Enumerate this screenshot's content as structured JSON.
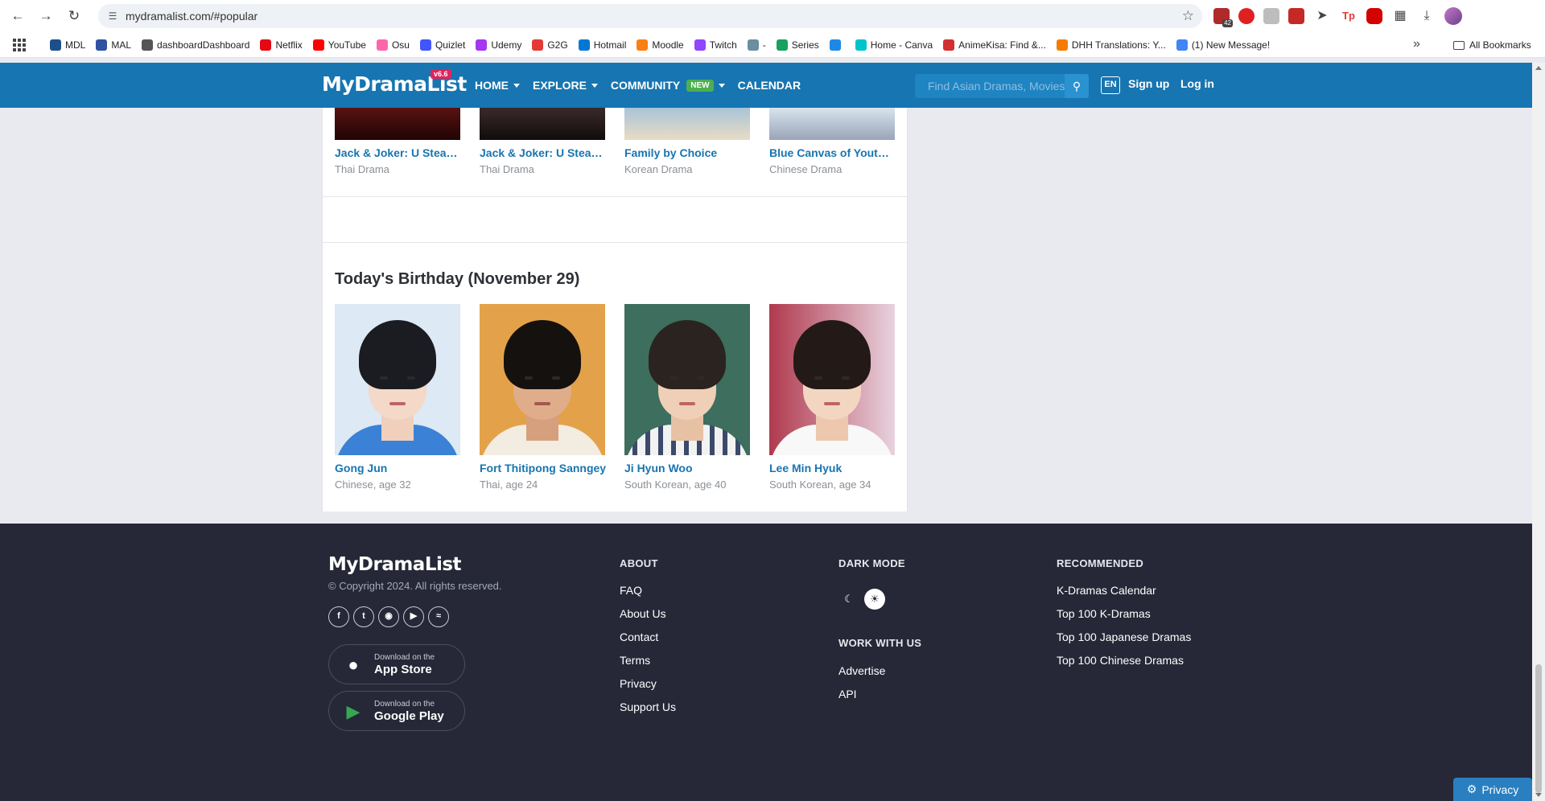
{
  "browser": {
    "url": "mydramalist.com/#popular",
    "bookmarks": [
      {
        "label": "MDL",
        "color": "#1d4f8c"
      },
      {
        "label": "MAL",
        "color": "#2e51a2"
      },
      {
        "label": "dashboardDashboard",
        "color": "#555555"
      },
      {
        "label": "Netflix",
        "color": "#e50914"
      },
      {
        "label": "YouTube",
        "color": "#ff0000"
      },
      {
        "label": "Osu",
        "color": "#ff66aa"
      },
      {
        "label": "Quizlet",
        "color": "#4255ff"
      },
      {
        "label": "Udemy",
        "color": "#a435f0"
      },
      {
        "label": "G2G",
        "color": "#e53935"
      },
      {
        "label": "Hotmail",
        "color": "#0078d4"
      },
      {
        "label": "Moodle",
        "color": "#f98012"
      },
      {
        "label": "Twitch",
        "color": "#9146ff"
      },
      {
        "label": "-",
        "color": "#6a8fa0"
      },
      {
        "label": "Series",
        "color": "#19a15f"
      },
      {
        "label": "",
        "color": "#1e88e5"
      },
      {
        "label": "Home - Canva",
        "color": "#00c4cc"
      },
      {
        "label": "AnimeKisa: Find &...",
        "color": "#d32f2f"
      },
      {
        "label": "DHH Translations: Y...",
        "color": "#f57c00"
      },
      {
        "label": "(1) New Message!",
        "color": "#4285f4"
      }
    ],
    "all_bookmarks": "All Bookmarks",
    "extension_badge": "42"
  },
  "header": {
    "logo": "MyDramaList",
    "version": "v6.6",
    "nav": {
      "home": "HOME",
      "explore": "EXPLORE",
      "community": "COMMUNITY",
      "new_badge": "NEW",
      "calendar": "CALENDAR"
    },
    "search_placeholder": "Find Asian Dramas, Movies, Actors...",
    "lang": "EN",
    "signup": "Sign up",
    "login": "Log in"
  },
  "popular_cards": [
    {
      "title": "Jack & Joker: U Steal My Heart!",
      "sub": "Thai Drama"
    },
    {
      "title": "Jack & Joker: U Steal My Heart!",
      "sub": "Thai Drama"
    },
    {
      "title": "Family by Choice",
      "sub": "Korean Drama"
    },
    {
      "title": "Blue Canvas of Youthful Days",
      "sub": "Chinese Drama"
    }
  ],
  "birthday": {
    "title": "Today's Birthday (November 29)",
    "people": [
      {
        "name": "Gong Jun",
        "sub": "Chinese, age 32"
      },
      {
        "name": "Fort Thitipong Sanngey",
        "sub": "Thai, age 24"
      },
      {
        "name": "Ji Hyun Woo",
        "sub": "South Korean, age 40"
      },
      {
        "name": "Lee Min Hyuk",
        "sub": "South Korean, age 34"
      }
    ]
  },
  "footer": {
    "logo": "MyDramaList",
    "copyright": "© Copyright 2024. All rights reserved.",
    "app_store_small": "Download on the",
    "app_store_big": "App Store",
    "google_small": "Download on the",
    "google_big": "Google Play",
    "about_head": "ABOUT",
    "about_links": [
      "FAQ",
      "About Us",
      "Contact",
      "Terms",
      "Privacy",
      "Support Us"
    ],
    "dark_mode_head": "DARK MODE",
    "work_head": "WORK WITH US",
    "work_links": [
      "Advertise",
      "API"
    ],
    "recommended_head": "RECOMMENDED",
    "recommended_links": [
      "K-Dramas Calendar",
      "Top 100 K-Dramas",
      "Top 100 Japanese Dramas",
      "Top 100 Chinese Dramas"
    ]
  },
  "privacy_button": "Privacy",
  "colors": {
    "brand_blue": "#1775b1",
    "footer_bg": "#262837",
    "link_blue": "#1775b1"
  }
}
